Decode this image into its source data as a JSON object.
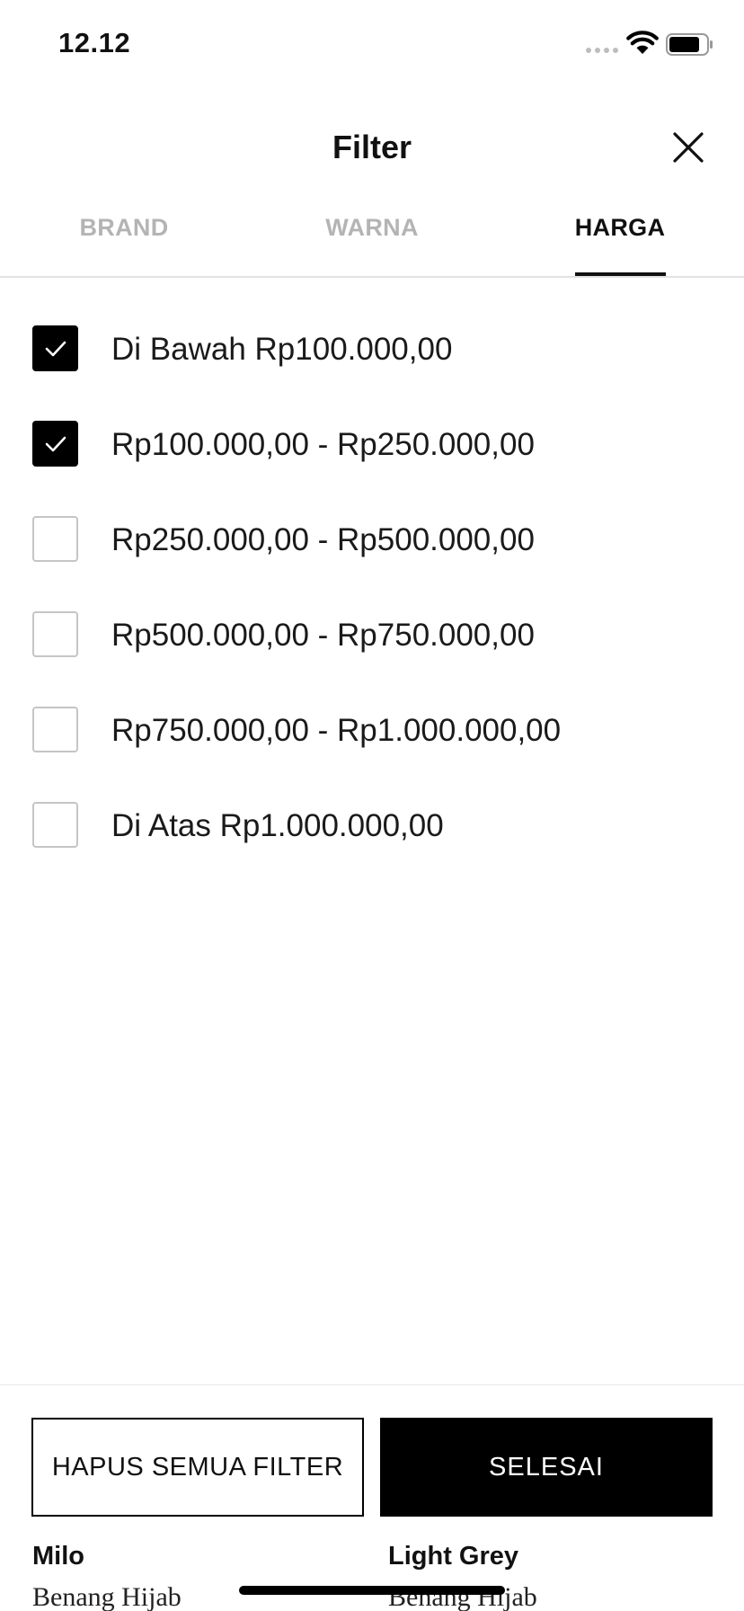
{
  "status_bar": {
    "time": "12.12",
    "signal_icon": "cellular-signal-icon",
    "wifi_icon": "wifi-icon",
    "battery_icon": "battery-icon"
  },
  "header": {
    "title": "Filter",
    "close_icon": "close-icon"
  },
  "tabs": [
    {
      "label": "BRAND",
      "active": false
    },
    {
      "label": "WARNA",
      "active": false
    },
    {
      "label": "HARGA",
      "active": true
    }
  ],
  "price_options": [
    {
      "label": "Di Bawah Rp100.000,00",
      "checked": true
    },
    {
      "label": "Rp100.000,00 - Rp250.000,00",
      "checked": true
    },
    {
      "label": "Rp250.000,00 - Rp500.000,00",
      "checked": false
    },
    {
      "label": "Rp500.000,00 - Rp750.000,00",
      "checked": false
    },
    {
      "label": "Rp750.000,00 - Rp1.000.000,00",
      "checked": false
    },
    {
      "label": "Di Atas Rp1.000.000,00",
      "checked": false
    }
  ],
  "actions": {
    "clear_label": "HAPUS SEMUA FILTER",
    "done_label": "SELESAI"
  },
  "background_products": [
    {
      "name": "Milo",
      "subtitle": "Benang Hijab"
    },
    {
      "name": "Light Grey",
      "subtitle": "Benang Hijab"
    }
  ],
  "colors": {
    "accent": "#000000",
    "inactive_tab": "#b4b4b4",
    "divider": "#e2e2e2"
  }
}
